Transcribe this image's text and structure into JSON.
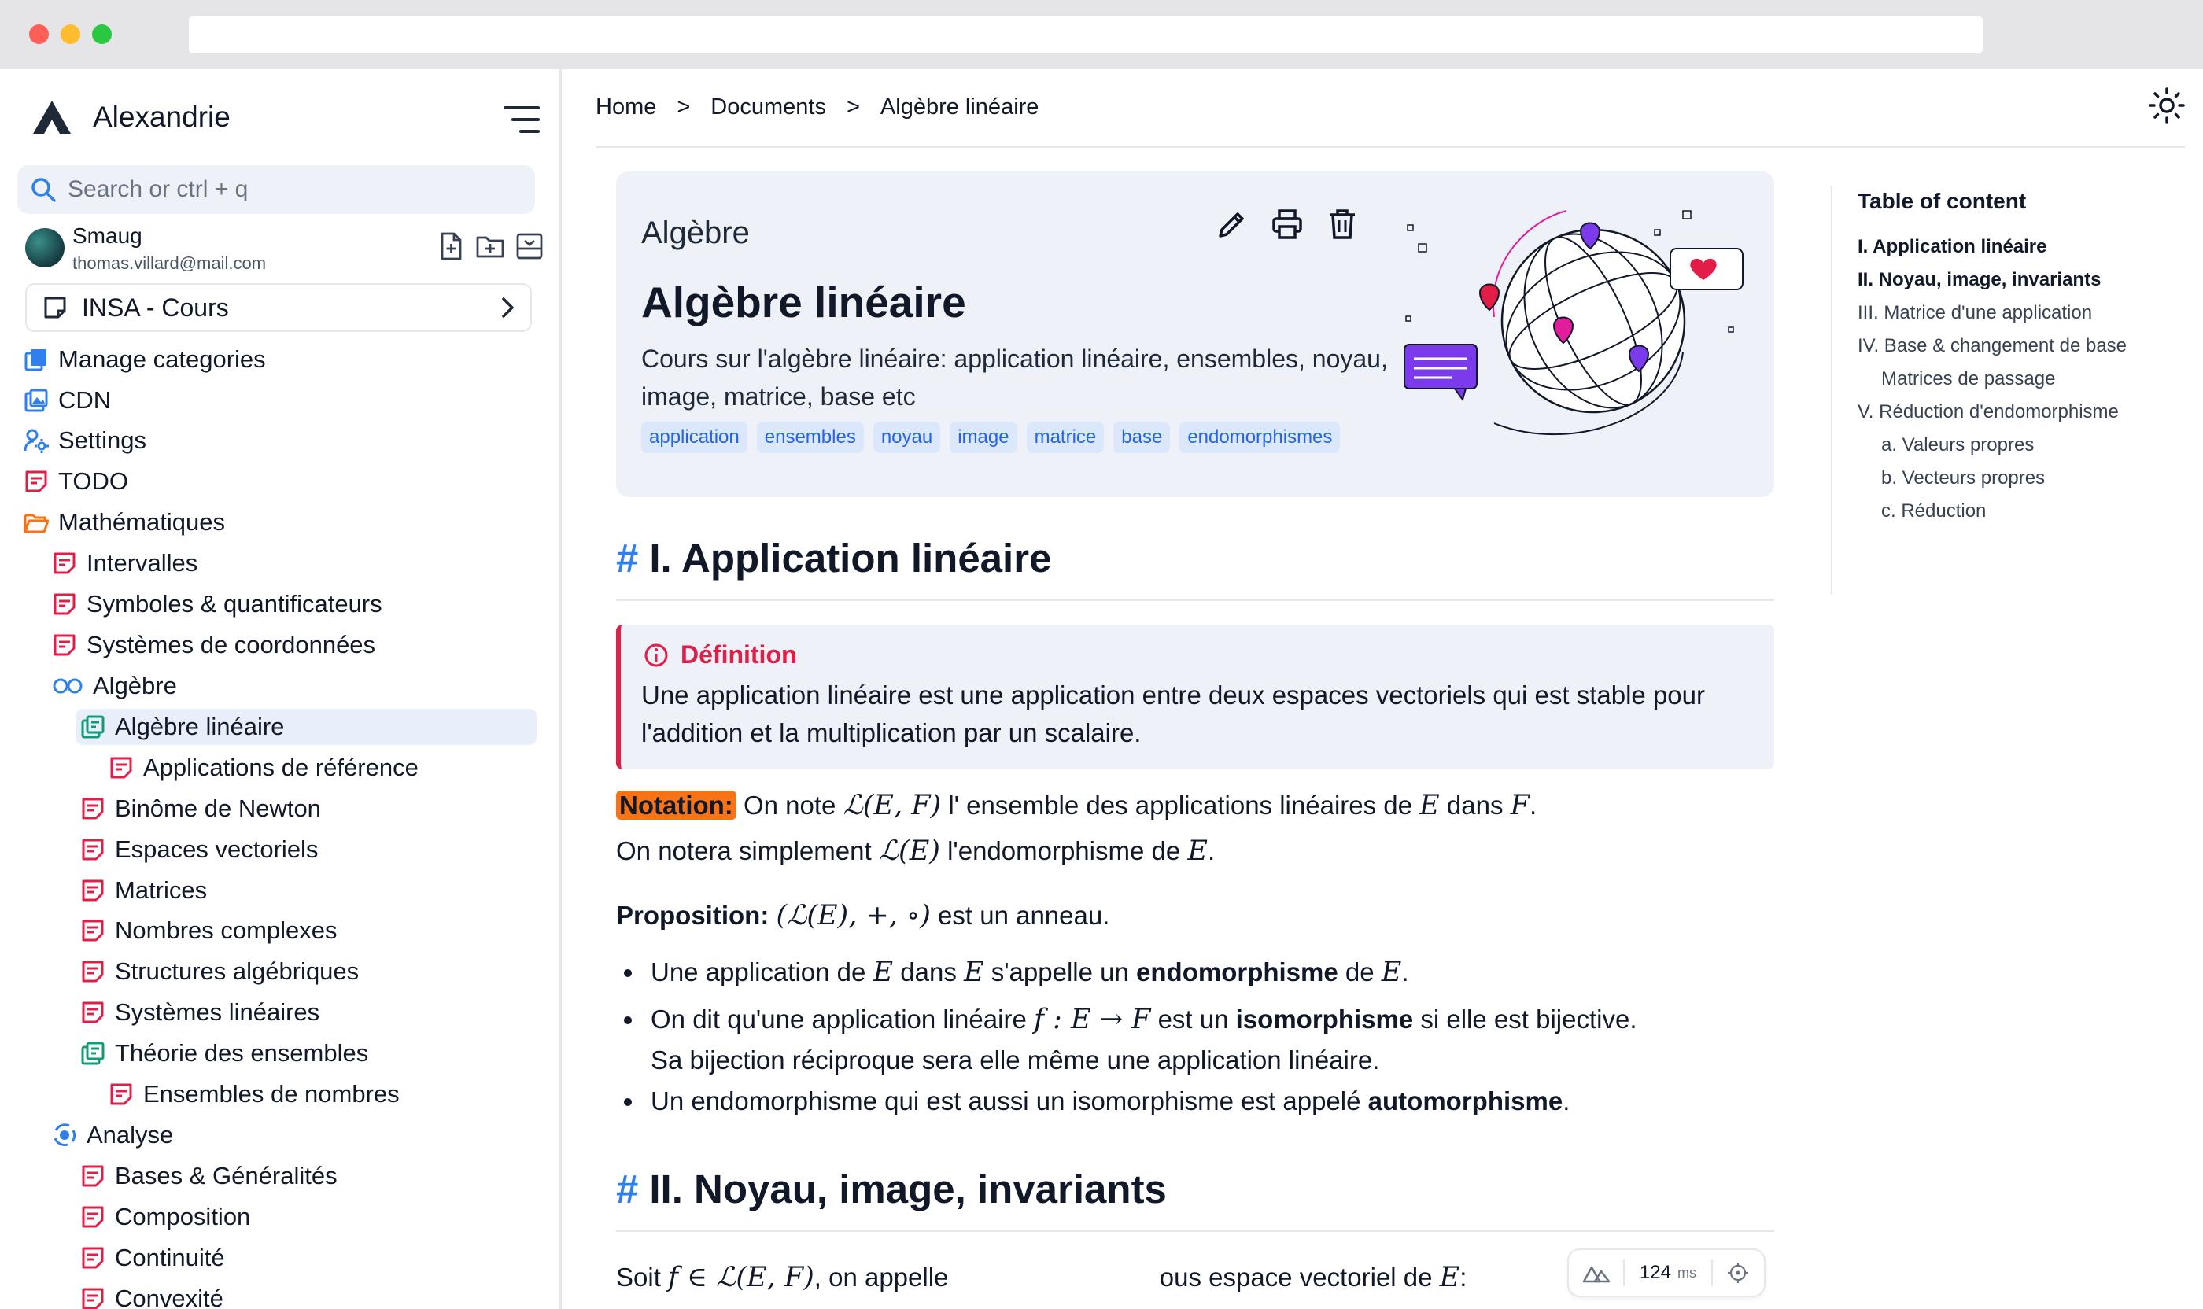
{
  "sidebar": {
    "brand": "Alexandrie",
    "search_placeholder": "Search or ctrl + q",
    "user": {
      "name": "Smaug",
      "email": "thomas.villard@mail.com"
    },
    "workspace": "INSA - Cours",
    "items": [
      {
        "label": "Manage categories",
        "icon": "categories-icon"
      },
      {
        "label": "CDN",
        "icon": "cdn-icon"
      },
      {
        "label": "Settings",
        "icon": "settings-icon"
      },
      {
        "label": "TODO",
        "icon": "document-icon"
      },
      {
        "label": "Mathématiques",
        "icon": "folder-open-icon"
      },
      {
        "label": "Intervalles",
        "icon": "document-icon"
      },
      {
        "label": "Symboles & quantificateurs",
        "icon": "document-icon"
      },
      {
        "label": "Systèmes de coordonnées",
        "icon": "document-icon"
      },
      {
        "label": "Algèbre",
        "icon": "infinity-icon"
      },
      {
        "label": "Algèbre linéaire",
        "icon": "category-doc-icon"
      },
      {
        "label": "Applications de référence",
        "icon": "document-icon"
      },
      {
        "label": "Binôme de Newton",
        "icon": "document-icon"
      },
      {
        "label": "Espaces vectoriels",
        "icon": "document-icon"
      },
      {
        "label": "Matrices",
        "icon": "document-icon"
      },
      {
        "label": "Nombres complexes",
        "icon": "document-icon"
      },
      {
        "label": "Structures algébriques",
        "icon": "document-icon"
      },
      {
        "label": "Systèmes linéaires",
        "icon": "document-icon"
      },
      {
        "label": "Théorie des ensembles",
        "icon": "category-doc-icon"
      },
      {
        "label": "Ensembles de nombres",
        "icon": "document-icon"
      },
      {
        "label": "Analyse",
        "icon": "analysis-icon"
      },
      {
        "label": "Bases & Généralités",
        "icon": "document-icon"
      },
      {
        "label": "Composition",
        "icon": "document-icon"
      },
      {
        "label": "Continuité",
        "icon": "document-icon"
      },
      {
        "label": "Convexité",
        "icon": "document-icon"
      }
    ]
  },
  "breadcrumb": [
    "Home",
    "Documents",
    "Algèbre linéaire"
  ],
  "breadcrumb_sep": ">",
  "document": {
    "category": "Algèbre",
    "title": "Algèbre linéaire",
    "description": "Cours sur l'algèbre linéaire: application linéaire, ensembles, noyau, image, matrice, base etc",
    "tags": [
      "application",
      "ensembles",
      "noyau",
      "image",
      "matrice",
      "base",
      "endomorphismes"
    ]
  },
  "content": {
    "hash": "#",
    "section1": "I. Application linéaire",
    "definition_title": "Définition",
    "definition_text": "Une application linéaire est une application entre deux espaces vectoriels qui est stable pour l'addition et la multiplication par un scalaire.",
    "notation_label": "Notation:",
    "notation_pre": "On note",
    "notation_mid": "l' ensemble des applications linéaires de",
    "notation_dans": "dans",
    "notation_line2_pre": "On notera simplement",
    "notation_line2_mid": "l'endomorphisme de",
    "proposition_label": "Proposition:",
    "proposition_math": "(ℒ(E), +, ∘)",
    "proposition_text": "est un anneau.",
    "b1_pre": "Une application de",
    "b1_dans": "dans",
    "b1_mid": "s'appelle un",
    "b1_bold": "endomorphisme",
    "b1_de": "de",
    "b2_pre": "On dit qu'une application linéaire",
    "b2_math": "f : E → F",
    "b2_mid": "est un",
    "b2_bold": "isomorphisme",
    "b2_post": "si elle est bijective.",
    "b2_cont": "Sa bijection réciproque sera elle même une application linéaire.",
    "b3_pre": "Un endomorphisme qui est aussi un isomorphisme est appelé",
    "b3_bold": "automorphisme",
    "section2": "II. Noyau, image, invariants",
    "soit_pre": "Soit",
    "soit_math": "f ∈ ℒ(E, F)",
    "soit_mid": ", on appelle",
    "soit_post": "ous espace vectoriel de",
    "math_LEF": "ℒ(E, F)",
    "math_LE": "ℒ(E)",
    "math_E": "E",
    "math_F": "F"
  },
  "toc": {
    "title": "Table of content",
    "items": [
      "I. Application linéaire",
      "II. Noyau, image, invariants",
      "III. Matrice d'une application",
      "IV. Base & changement de base",
      "Matrices de passage",
      "V. Réduction d'endomorphisme",
      "a. Valeurs propres",
      "b. Vecteurs propres",
      "c. Réduction"
    ]
  },
  "devtools": {
    "value": "124",
    "unit": "ms"
  },
  "colors": {
    "accent": "#2f80ed",
    "definition": "#e11d48",
    "notation": "#f97316",
    "doc_icon": "#e11d48",
    "category_icon": "#0f9d76"
  }
}
